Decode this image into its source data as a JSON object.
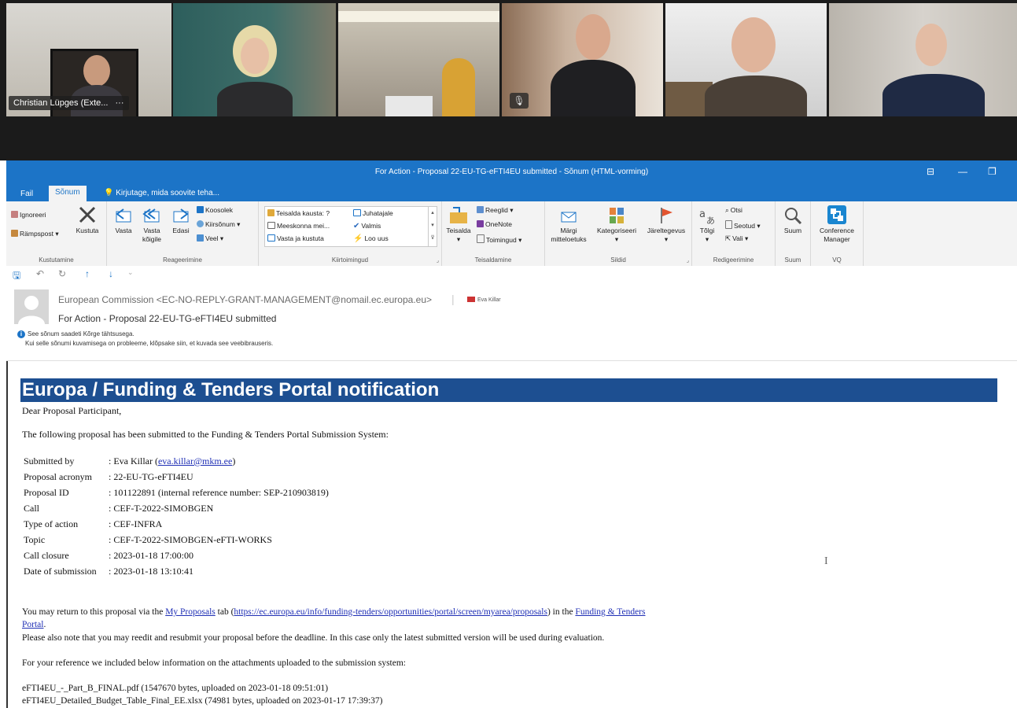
{
  "video": {
    "participant_name": "Christian Lüpges (Exte...",
    "more_glyph": "···"
  },
  "window": {
    "title": "For Action - Proposal 22-EU-TG-eFTI4EU  submitted - Sõnum (HTML-vorming)"
  },
  "tabs": [
    "Fail",
    "Sõnum"
  ],
  "tell_me": "Kirjutage, mida soovite teha...",
  "ribbon": {
    "delete": {
      "ignore": "Ignoreeri",
      "junk": "Rämpspost",
      "delete": "Kustuta",
      "label": "Kustutamine"
    },
    "respond": {
      "reply": "Vasta",
      "reply_all_1": "Vasta",
      "reply_all_2": "kõigile",
      "forward": "Edasi",
      "meeting": "Koosolek",
      "im": "Kiirsõnum",
      "more": "Veel",
      "label": "Reageerimine"
    },
    "quicksteps": {
      "item1": "Teisalda kausta: ?",
      "item2": "Meeskonna mei...",
      "item3": "Vasta ja kustuta",
      "item4": "Juhatajale",
      "item5": "Valmis",
      "item6": "Loo uus",
      "label": "Kiirtoimingud"
    },
    "move": {
      "move": "Teisalda",
      "rules": "Reeglid",
      "onenote": "OneNote",
      "actions": "Toimingud",
      "label": "Teisaldamine"
    },
    "tags": {
      "mark_1": "Märgi",
      "mark_2": "mitteloetuks",
      "categorize": "Kategoriseeri",
      "followup": "Järeltegevus",
      "label": "Sildid"
    },
    "editing": {
      "translate": "Tõlgi",
      "find": "Otsi",
      "related": "Seotud",
      "select": "Vali",
      "label": "Redigeerimine"
    },
    "zoom": {
      "zoom": "Suum",
      "label": "Suum"
    },
    "vq": {
      "conf_1": "Conference",
      "conf_2": "Manager",
      "label": "VQ"
    }
  },
  "message": {
    "from": "European Commission <EC-NO-REPLY-GRANT-MANAGEMENT@nomail.ec.europa.eu>",
    "recipient": "Eva Killar",
    "subject": "For Action - Proposal 22-EU-TG-eFTI4EU  submitted",
    "info_line1": "See sõnum saadeti Kõrge tähtsusega.",
    "info_line2": "Kui selle sõnumi kuvamisega on probleeme, klõpsake siin, et kuvada see veebibrauseris."
  },
  "body": {
    "banner": "Europa / Funding & Tenders Portal notification",
    "greeting": "Dear Proposal Participant,",
    "intro": "The following proposal has been submitted to the Funding & Tenders Portal Submission System:",
    "details": [
      {
        "key": "Submitted by",
        "value_pre": ": Eva Killar (",
        "value_link": "eva.killar@mkm.ee",
        "value_post": ")"
      },
      {
        "key": "Proposal acronym",
        "value": ": 22-EU-TG-eFTI4EU"
      },
      {
        "key": "Proposal ID",
        "value": ": 101122891 (internal reference number: SEP-210903819)"
      },
      {
        "key": "Call",
        "value": ": CEF-T-2022-SIMOBGEN"
      },
      {
        "key": "Type of action",
        "value": ": CEF-INFRA"
      },
      {
        "key": "Topic",
        "value": ": CEF-T-2022-SIMOBGEN-eFTI-WORKS"
      },
      {
        "key": "Call closure",
        "value": ": 2023-01-18 17:00:00"
      },
      {
        "key": "Date of submission",
        "value": ": 2023-01-18 13:10:41"
      }
    ],
    "return_pre": "You may return to this proposal via the ",
    "return_link1": "My Proposals",
    "return_mid": " tab (",
    "return_link2": "https://ec.europa.eu/info/funding-tenders/opportunities/portal/screen/myarea/proposals",
    "return_mid2": ") in the ",
    "return_link3a": "Funding & Tenders",
    "return_link3b": "Portal",
    "return_post": ".",
    "reedit": "Please also note that you may reedit and resubmit your proposal before the deadline. In this case only the latest submitted version will be used during evaluation.",
    "attach_intro": "For your reference we included below information on the attachments uploaded to the submission system:",
    "attachments": [
      "eFTI4EU_-_Part_B_FINAL.pdf (1547670 bytes, uploaded on 2023-01-18 09:51:01)",
      "eFTI4EU_Detailed_Budget_Table_Final_EE.xlsx (74981 bytes, uploaded on 2023-01-17 17:39:37)"
    ]
  }
}
